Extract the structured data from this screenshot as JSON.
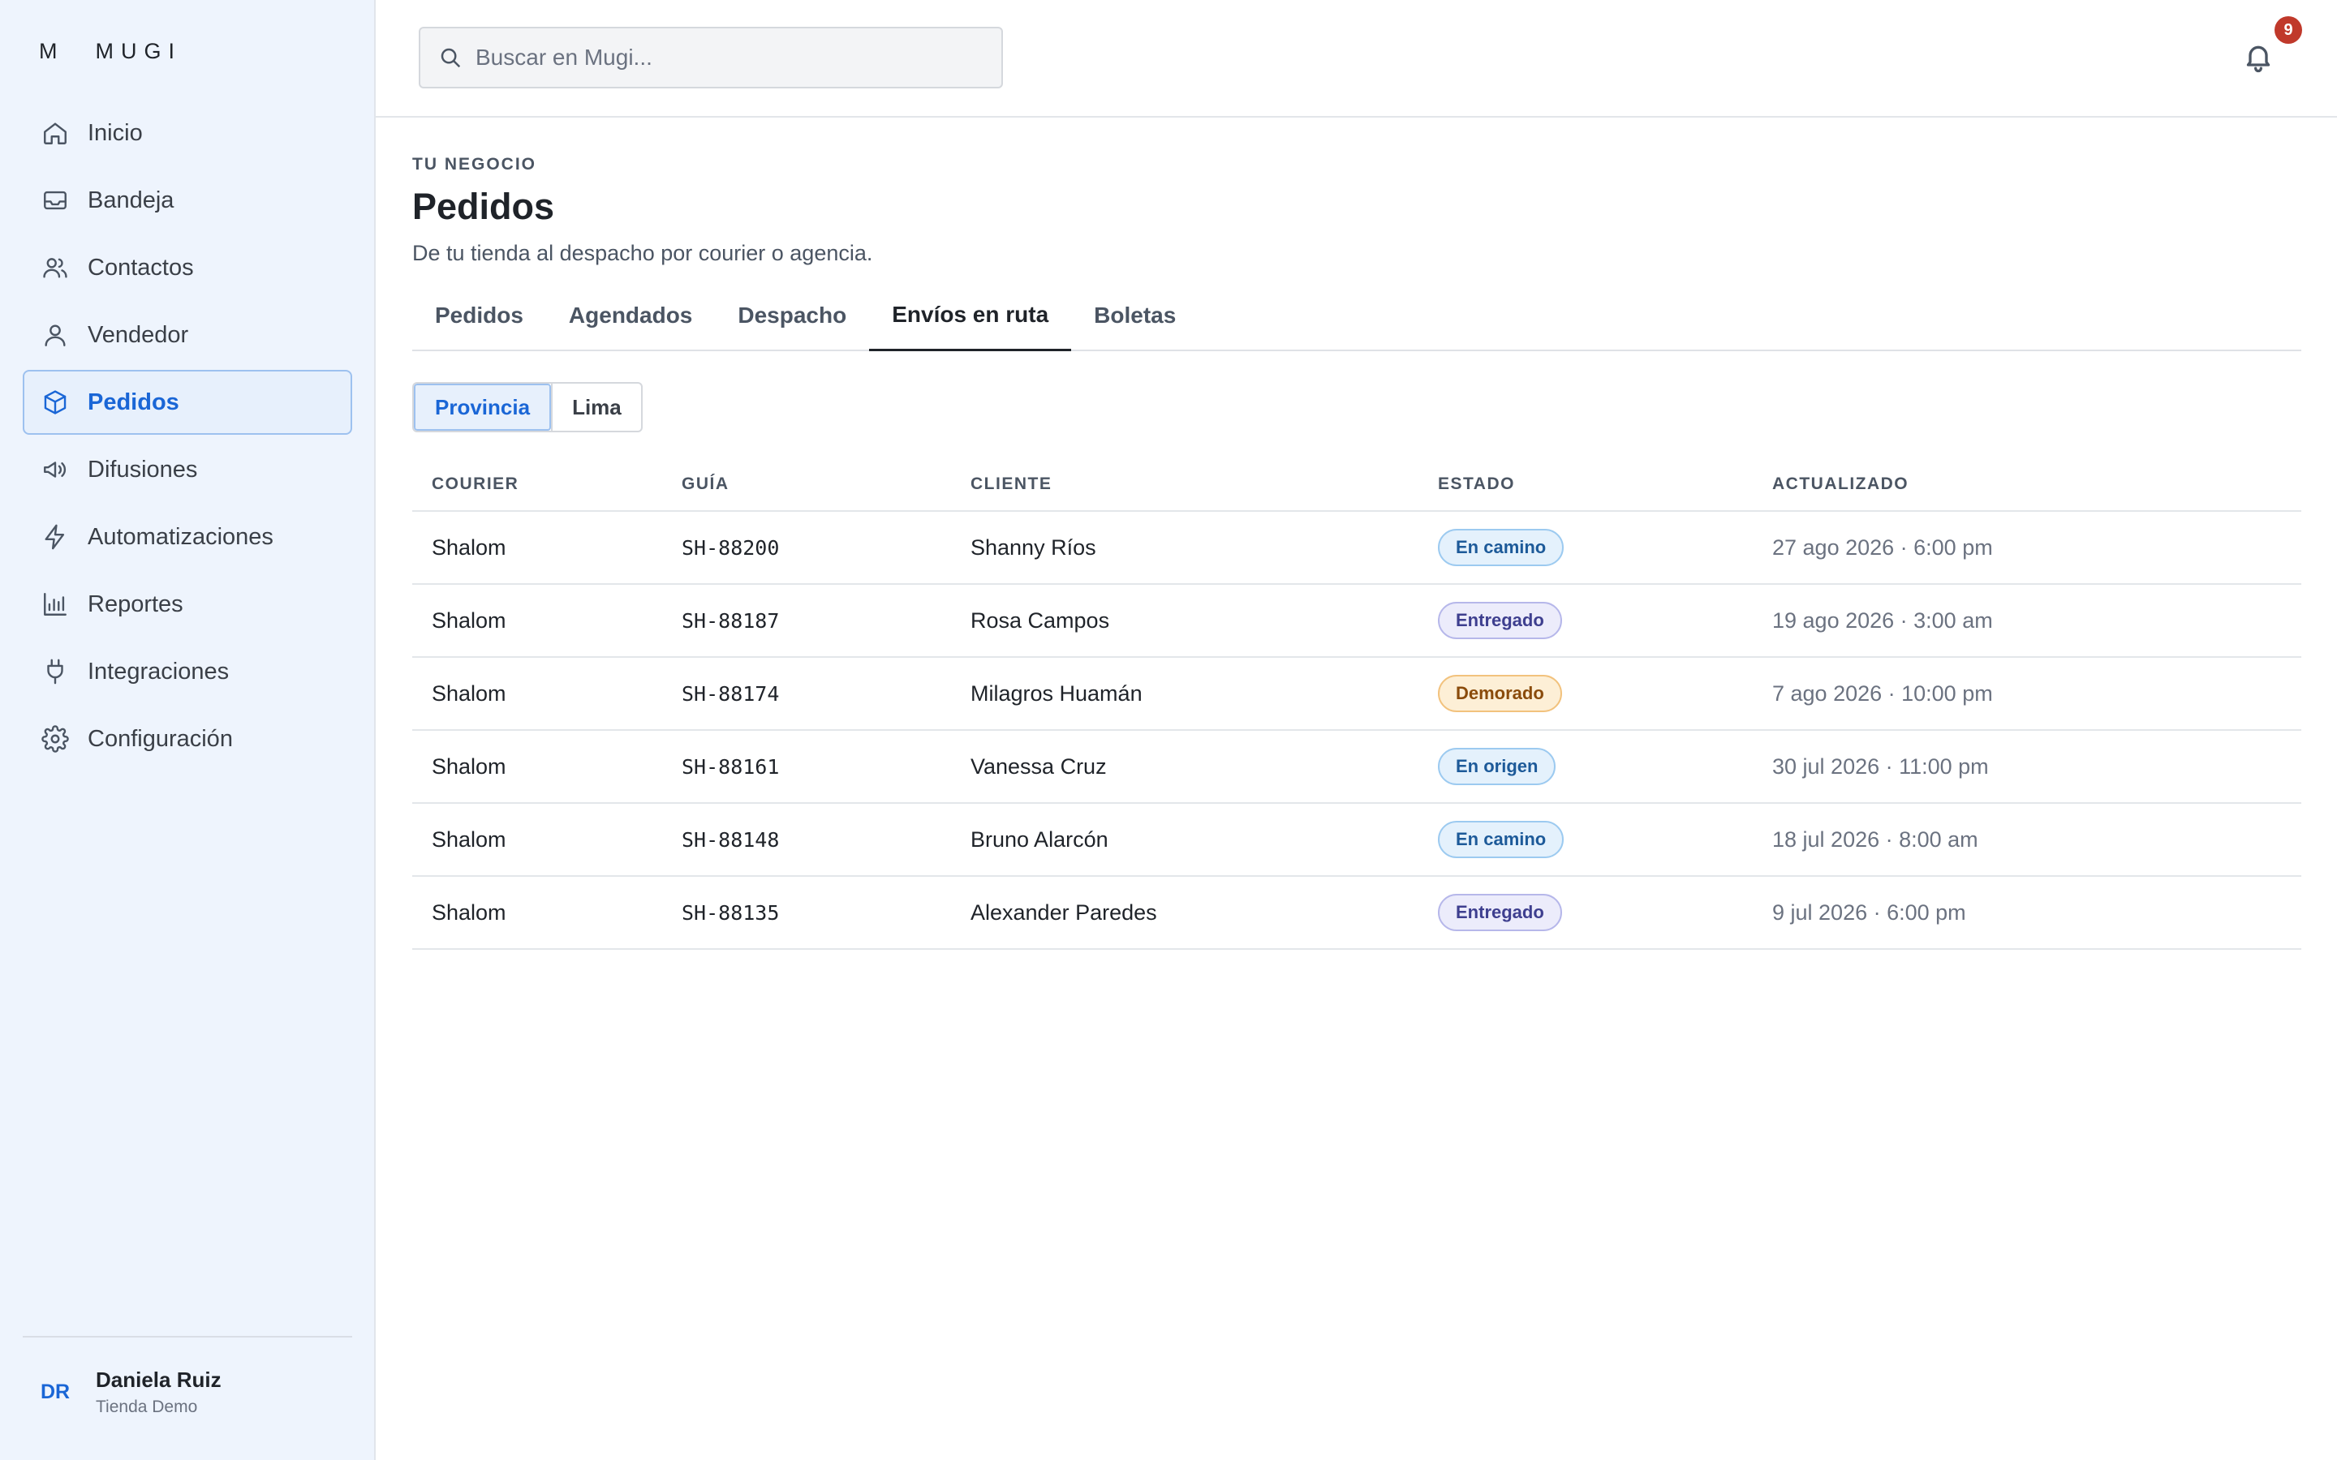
{
  "app": {
    "logo_mark": "M",
    "logo_text": "MUGI"
  },
  "sidebar": {
    "items": [
      {
        "label": "Inicio",
        "icon": "home-icon"
      },
      {
        "label": "Bandeja",
        "icon": "inbox-icon"
      },
      {
        "label": "Contactos",
        "icon": "users-icon"
      },
      {
        "label": "Vendedor",
        "icon": "user-icon"
      },
      {
        "label": "Pedidos",
        "icon": "box-icon",
        "active": true
      },
      {
        "label": "Difusiones",
        "icon": "megaphone-icon"
      },
      {
        "label": "Automatizaciones",
        "icon": "bolt-icon"
      },
      {
        "label": "Reportes",
        "icon": "bar-chart-icon"
      },
      {
        "label": "Integraciones",
        "icon": "plug-icon"
      },
      {
        "label": "Configuración",
        "icon": "gear-icon"
      }
    ],
    "user": {
      "initials": "DR",
      "name": "Daniela Ruiz",
      "store": "Tienda Demo"
    }
  },
  "topbar": {
    "search_placeholder": "Buscar en Mugi...",
    "notifications_count": "9"
  },
  "page": {
    "eyebrow": "TU NEGOCIO",
    "title": "Pedidos",
    "description": "De tu tienda al despacho por courier o agencia."
  },
  "tabs": [
    {
      "label": "Pedidos"
    },
    {
      "label": "Agendados"
    },
    {
      "label": "Despacho"
    },
    {
      "label": "Envíos en ruta",
      "active": true
    },
    {
      "label": "Boletas"
    }
  ],
  "segments": [
    {
      "label": "Provincia",
      "active": true
    },
    {
      "label": "Lima"
    }
  ],
  "table": {
    "headers": {
      "courier": "COURIER",
      "guia": "GUÍA",
      "cliente": "CLIENTE",
      "estado": "ESTADO",
      "actualizado": "ACTUALIZADO"
    },
    "rows": [
      {
        "courier": "Shalom",
        "guia": "SH-88200",
        "cliente": "Shanny Ríos",
        "estado": "En camino",
        "actualizado": "27 ago 2026 · 6:00 pm"
      },
      {
        "courier": "Shalom",
        "guia": "SH-88187",
        "cliente": "Rosa Campos",
        "estado": "Entregado",
        "actualizado": "19 ago 2026 · 3:00 am"
      },
      {
        "courier": "Shalom",
        "guia": "SH-88174",
        "cliente": "Milagros Huamán",
        "estado": "Demorado",
        "actualizado": "7 ago 2026 · 10:00 pm"
      },
      {
        "courier": "Shalom",
        "guia": "SH-88161",
        "cliente": "Vanessa Cruz",
        "estado": "En origen",
        "actualizado": "30 jul 2026 · 11:00 pm"
      },
      {
        "courier": "Shalom",
        "guia": "SH-88148",
        "cliente": "Bruno Alarcón",
        "estado": "En camino",
        "actualizado": "18 jul 2026 · 8:00 am"
      },
      {
        "courier": "Shalom",
        "guia": "SH-88135",
        "cliente": "Alexander Paredes",
        "estado": "Entregado",
        "actualizado": "9 jul 2026 · 6:00 pm"
      }
    ]
  },
  "status_colors": {
    "En camino": {
      "bg": "#e4f1fc",
      "border": "#9ccaf0",
      "text": "#1d5a99"
    },
    "Entregado": {
      "bg": "#ececfb",
      "border": "#b6b7ea",
      "text": "#3e3f8f"
    },
    "Demorado": {
      "bg": "#fdefd6",
      "border": "#f2c27d",
      "text": "#8a4b0b"
    },
    "En origen": {
      "bg": "#e4f1fc",
      "border": "#9ccaf0",
      "text": "#1d5a99"
    }
  }
}
